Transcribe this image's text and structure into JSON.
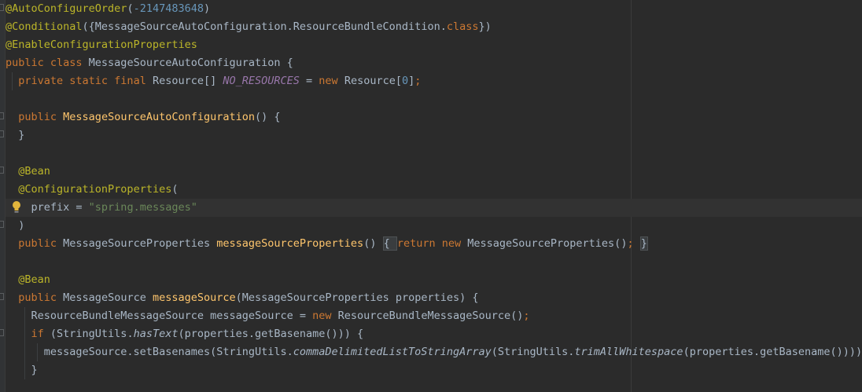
{
  "editor": {
    "language": "Java",
    "accent_colors": {
      "keyword": "#cc7832",
      "annotation": "#bbb529",
      "number": "#6897bb",
      "string": "#6a8759",
      "method": "#ffc66d",
      "constant": "#9876aa",
      "text": "#a9b7c6",
      "background": "#2b2b2b"
    },
    "lines": [
      [
        {
          "t": "@AutoConfigureOrder",
          "c": "ann"
        },
        {
          "t": "(",
          "c": ""
        },
        {
          "t": "-2147483648",
          "c": "num"
        },
        {
          "t": ")",
          "c": ""
        }
      ],
      [
        {
          "t": "@Conditional",
          "c": "ann"
        },
        {
          "t": "({MessageSourceAutoConfiguration.ResourceBundleCondition.",
          "c": ""
        },
        {
          "t": "class",
          "c": "kw"
        },
        {
          "t": "})",
          "c": ""
        }
      ],
      [
        {
          "t": "@EnableConfigurationProperties",
          "c": "ann"
        }
      ],
      [
        {
          "t": "public class ",
          "c": "kw"
        },
        {
          "t": "MessageSourceAutoConfiguration {",
          "c": ""
        }
      ],
      [
        {
          "t": "  ",
          "c": ""
        },
        {
          "t": "private static final ",
          "c": "kw"
        },
        {
          "t": "Resource[] ",
          "c": ""
        },
        {
          "t": "NO_RESOURCES",
          "c": "const"
        },
        {
          "t": " = ",
          "c": ""
        },
        {
          "t": "new ",
          "c": "kw"
        },
        {
          "t": "Resource[",
          "c": ""
        },
        {
          "t": "0",
          "c": "num"
        },
        {
          "t": "]",
          "c": ""
        },
        {
          "t": ";",
          "c": "kw"
        }
      ],
      [],
      [
        {
          "t": "  ",
          "c": ""
        },
        {
          "t": "public ",
          "c": "kw"
        },
        {
          "t": "MessageSourceAutoConfiguration",
          "c": "fn"
        },
        {
          "t": "() {",
          "c": ""
        }
      ],
      [
        {
          "t": "  }",
          "c": ""
        }
      ],
      [],
      [
        {
          "t": "  ",
          "c": ""
        },
        {
          "t": "@Bean",
          "c": "ann"
        }
      ],
      [
        {
          "t": "  ",
          "c": ""
        },
        {
          "t": "@ConfigurationProperties",
          "c": "ann"
        },
        {
          "t": "(",
          "c": ""
        }
      ],
      [
        {
          "t": "    prefix = ",
          "c": ""
        },
        {
          "t": "\"spring.messages\"",
          "c": "str"
        }
      ],
      [
        {
          "t": "  )",
          "c": ""
        }
      ],
      [
        {
          "t": "  ",
          "c": ""
        },
        {
          "t": "public ",
          "c": "kw"
        },
        {
          "t": "MessageSourceProperties ",
          "c": ""
        },
        {
          "t": "messageSourceProperties",
          "c": "fn"
        },
        {
          "t": "() ",
          "c": ""
        },
        {
          "t": "{ ",
          "c": "fold"
        },
        {
          "t": "return new ",
          "c": "kw"
        },
        {
          "t": "MessageSourceProperties()",
          "c": ""
        },
        {
          "t": ";",
          "c": "kw"
        },
        {
          "t": " ",
          "c": ""
        },
        {
          "t": "}",
          "c": "fold"
        }
      ],
      [],
      [
        {
          "t": "  ",
          "c": ""
        },
        {
          "t": "@Bean",
          "c": "ann"
        }
      ],
      [
        {
          "t": "  ",
          "c": ""
        },
        {
          "t": "public ",
          "c": "kw"
        },
        {
          "t": "MessageSource ",
          "c": ""
        },
        {
          "t": "messageSource",
          "c": "fn"
        },
        {
          "t": "(MessageSourceProperties properties) {",
          "c": ""
        }
      ],
      [
        {
          "t": "    ResourceBundleMessageSource messageSource = ",
          "c": ""
        },
        {
          "t": "new ",
          "c": "kw"
        },
        {
          "t": "ResourceBundleMessageSource()",
          "c": ""
        },
        {
          "t": ";",
          "c": "kw"
        }
      ],
      [
        {
          "t": "    ",
          "c": ""
        },
        {
          "t": "if ",
          "c": "kw"
        },
        {
          "t": "(StringUtils.",
          "c": ""
        },
        {
          "t": "hasText",
          "c": "static"
        },
        {
          "t": "(properties.getBasename())) {",
          "c": ""
        }
      ],
      [
        {
          "t": "      messageSource.setBasenames(StringUtils.",
          "c": ""
        },
        {
          "t": "commaDelimitedListToStringArray",
          "c": "static"
        },
        {
          "t": "(StringUtils.",
          "c": ""
        },
        {
          "t": "trimAllWhitespace",
          "c": "static"
        },
        {
          "t": "(properties.getBasename()))))",
          "c": ""
        },
        {
          "t": ";",
          "c": "kw"
        }
      ],
      [
        {
          "t": "    }",
          "c": ""
        }
      ]
    ]
  }
}
